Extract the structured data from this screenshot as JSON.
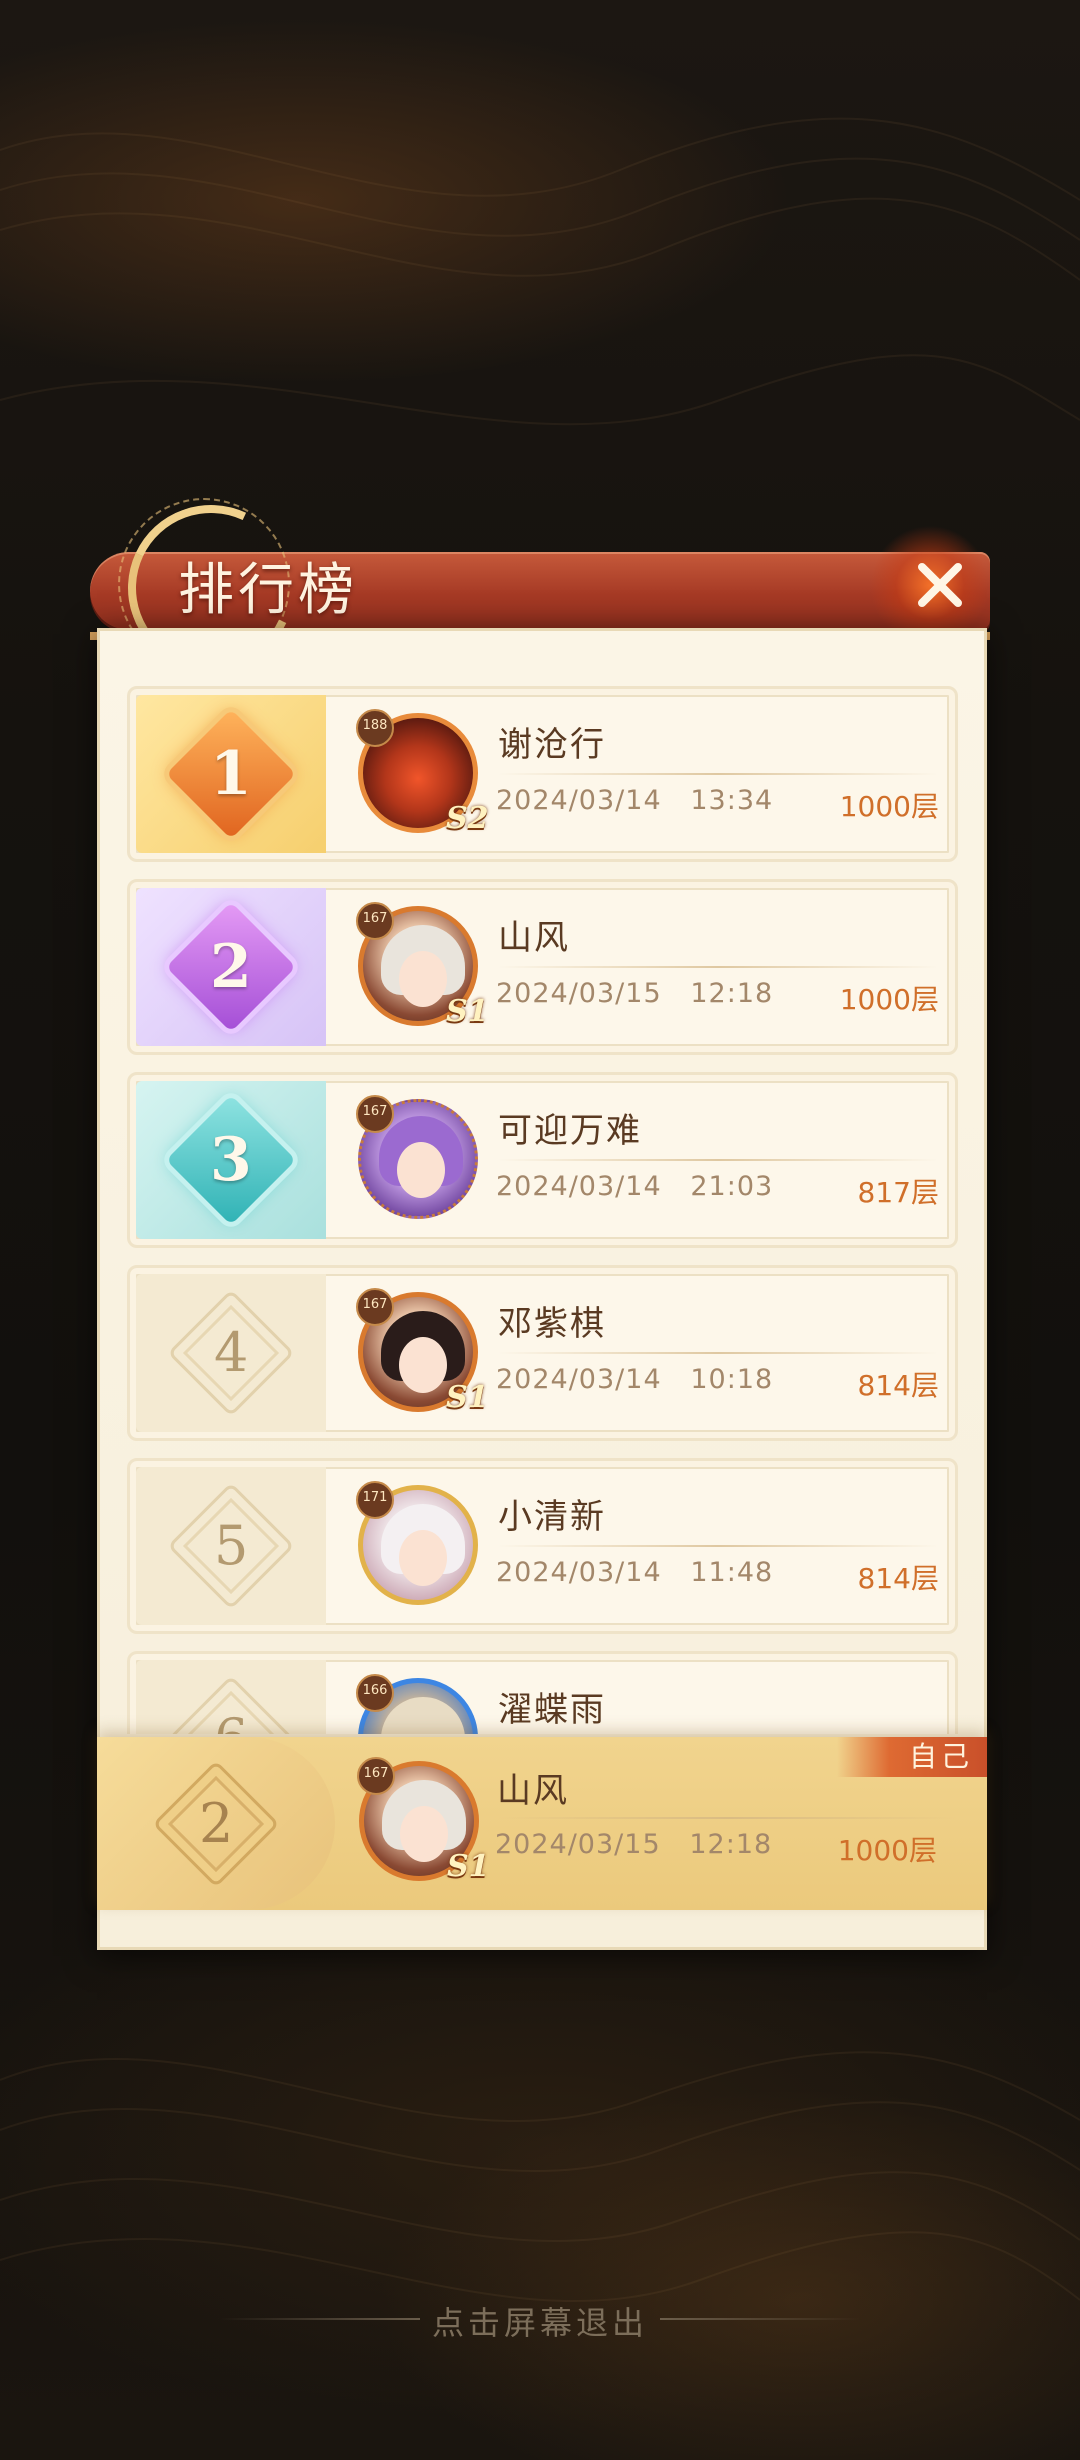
{
  "header": {
    "title": "排行榜"
  },
  "rows": [
    {
      "rank": "1",
      "level": "188",
      "tier": "S2",
      "name": "谢沧行",
      "date": "2024/03/14   13:34",
      "floor": "1000层"
    },
    {
      "rank": "2",
      "level": "167",
      "tier": "S1",
      "name": "山风",
      "date": "2024/03/15   12:18",
      "floor": "1000层"
    },
    {
      "rank": "3",
      "level": "167",
      "tier": "",
      "name": "可迎万难",
      "date": "2024/03/14   21:03",
      "floor": "817层"
    },
    {
      "rank": "4",
      "level": "167",
      "tier": "S1",
      "name": "邓紫棋",
      "date": "2024/03/14   10:18",
      "floor": "814层"
    },
    {
      "rank": "5",
      "level": "171",
      "tier": "",
      "name": "小清新",
      "date": "2024/03/14   11:48",
      "floor": "814层"
    },
    {
      "rank": "6",
      "level": "166",
      "tier": "",
      "name": "濯蝶雨",
      "date": "",
      "floor": ""
    }
  ],
  "self": {
    "tag": "自己",
    "rank": "2",
    "level": "167",
    "tier": "S1",
    "name": "山风",
    "date": "2024/03/15   12:18",
    "floor": "1000层"
  },
  "footer": {
    "exit_hint": "点击屏幕退出"
  },
  "colors": {
    "accent": "#d06f2a",
    "header": "#a63a25",
    "panel": "#fbf5e6"
  }
}
